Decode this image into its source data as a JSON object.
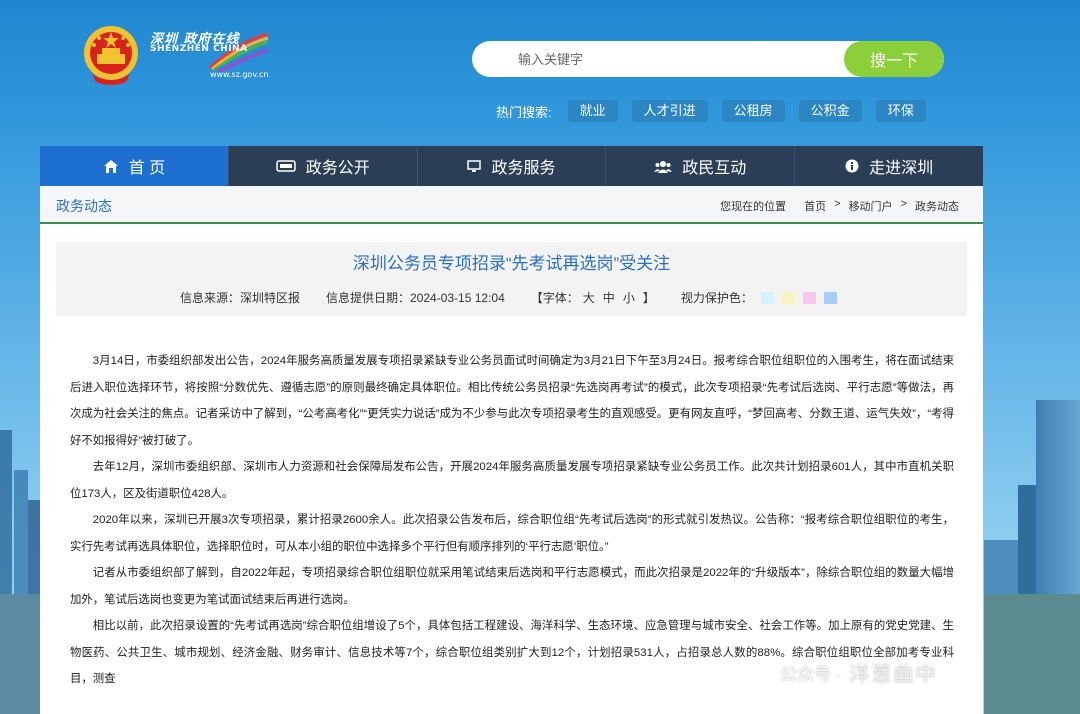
{
  "header": {
    "logo": {
      "cn": "深圳 政府在线",
      "en": "SHENZHEN CHINA",
      "url": "www.sz.gov.cn"
    },
    "search": {
      "placeholder": "输入关键字",
      "button": "搜一下"
    },
    "hot": {
      "label": "热门搜索:",
      "tags": [
        "就业",
        "人才引进",
        "公租房",
        "公积金",
        "环保"
      ]
    }
  },
  "nav": {
    "items": [
      {
        "label": "首 页",
        "icon": "home-icon"
      },
      {
        "label": "政务公开",
        "icon": "news-icon"
      },
      {
        "label": "政务服务",
        "icon": "monitor-icon"
      },
      {
        "label": "政民互动",
        "icon": "people-icon"
      },
      {
        "label": "走进深圳",
        "icon": "info-icon"
      }
    ]
  },
  "breadcrumb": {
    "title": "政务动态",
    "location_label": "您现在的位置",
    "items": [
      "首页",
      "移动门户",
      "政务动态"
    ],
    "sep": ">"
  },
  "article": {
    "title": "深圳公务员专项招录“先考试再选岗”受关注",
    "source": "信息来源：深圳特区报",
    "date": "信息提供日期：2024-03-15 12:04",
    "font_label_open": "【字体：",
    "font_sizes": [
      "大",
      "中",
      "小"
    ],
    "font_label_close": "】",
    "eye_label": "视力保护色：",
    "eye_colors": [
      "#d8f2fb",
      "#f6f4c2",
      "#f7c6f0",
      "#a9cdf9"
    ],
    "paragraphs": [
      "3月14日，市委组织部发出公告，2024年服务高质量发展专项招录紧缺专业公务员面试时间确定为3月21日下午至3月24日。报考综合职位组职位的入围考生，将在面试结束后进入职位选择环节，将按照“分数优先、遵循志愿”的原则最终确定具体职位。相比传统公务员招录“先选岗再考试”的模式，此次专项招录“先考试后选岗、平行志愿”等做法，再次成为社会关注的焦点。记者采访中了解到，“公考高考化”“更凭实力说话”成为不少参与此次专项招录考生的直观感受。更有网友直呼，“梦回高考、分数王道、运气失效”，“考得好不如报得好”被打破了。",
      "去年12月，深圳市委组织部、深圳市人力资源和社会保障局发布公告，开展2024年服务高质量发展专项招录紧缺专业公务员工作。此次共计划招录601人，其中市直机关职位173人，区及街道职位428人。",
      "2020年以来，深圳已开展3次专项招录，累计招录2600余人。此次招录公告发布后，综合职位组“先考试后选岗”的形式就引发热议。公告称：“报考综合职位组职位的考生，实行先考试再选具体职位，选择职位时，可从本小组的职位中选择多个平行但有顺序排列的‘平行志愿’职位。”",
      "记者从市委组织部了解到，自2022年起，专项招录综合职位组职位就采用笔试结束后选岗和平行志愿模式，而此次招录是2022年的“升级版本”，除综合职位组的数量大幅增加外，笔试后选岗也变更为笔试面试结束后再进行选岗。",
      "相比以前，此次招录设置的“先考试再选岗”综合职位组增设了5个，具体包括工程建设、海洋科学、生态环境、应急管理与城市安全、社会工作等。加上原有的党史党建、生物医药、公共卫生、城市规划、经济金融、财务审计、信息技术等7个，综合职位组类别扩大到12个，计划招录531人，占招录总人数的88%。综合职位组职位全部加考专业科目，测查"
    ]
  },
  "watermark": {
    "text": "公众号 ·",
    "brand": "洋葱曲中"
  }
}
